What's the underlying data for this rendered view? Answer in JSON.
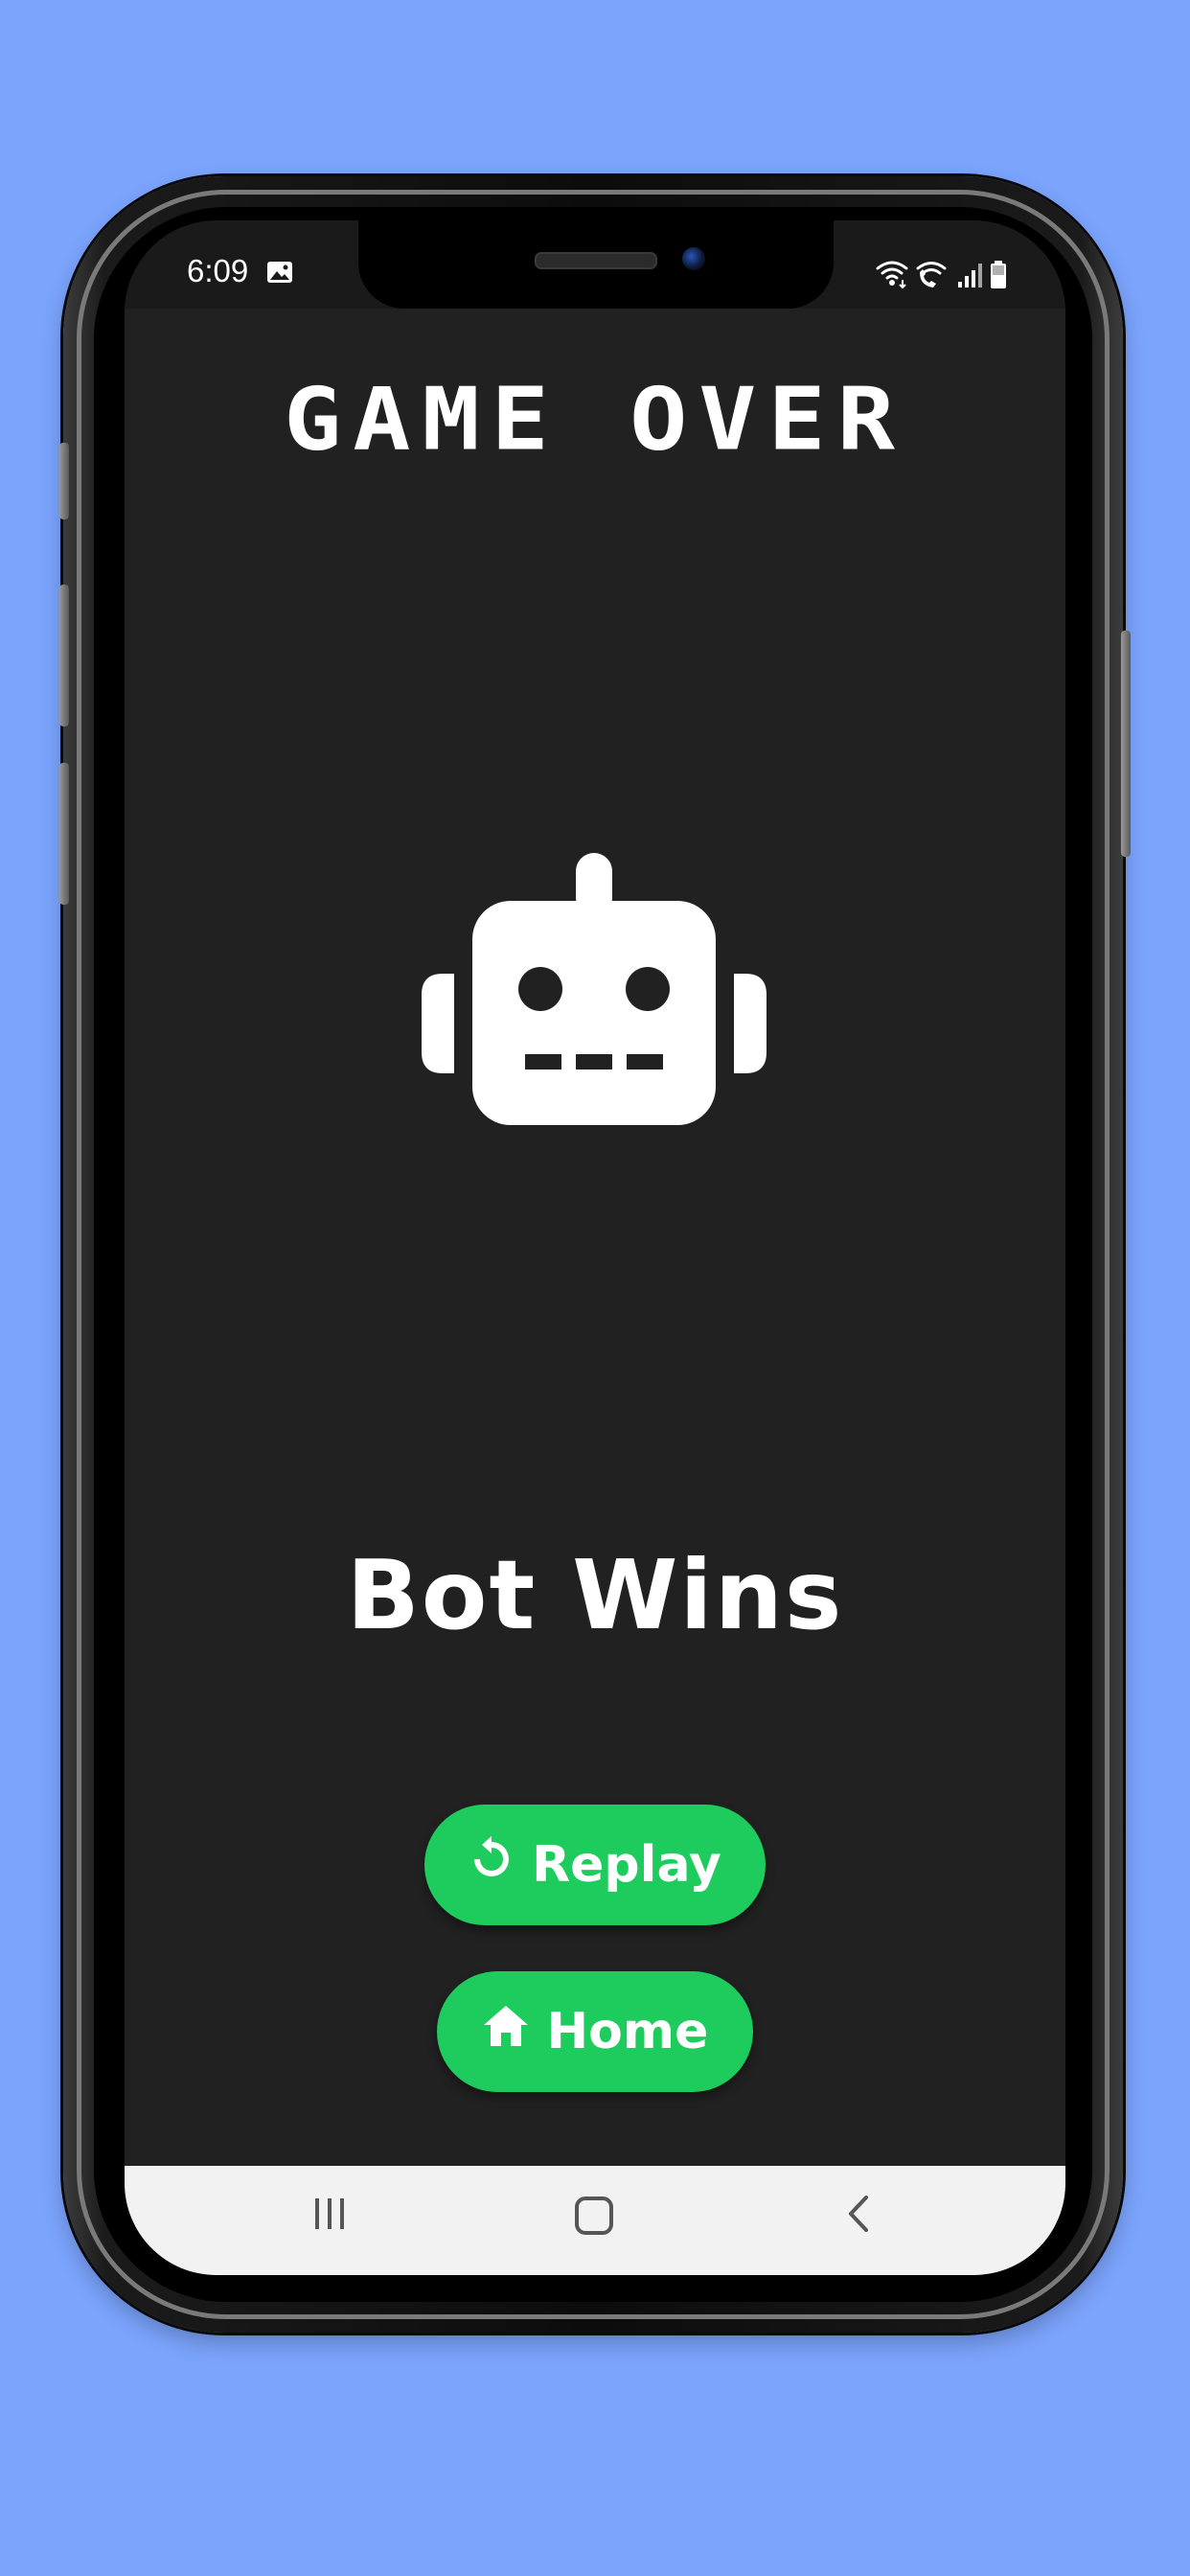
{
  "status_bar": {
    "time": "6:09",
    "left_icons": [
      "gallery-icon"
    ],
    "right_icons": [
      "wifi-call-icon",
      "wifi-calling-icon",
      "signal-icon",
      "battery-icon"
    ]
  },
  "game": {
    "title": "GAME OVER",
    "winner_icon": "robot-icon",
    "result_text": "Bot Wins"
  },
  "buttons": {
    "replay_label": "Replay",
    "replay_icon": "replay-icon",
    "home_label": "Home",
    "home_icon": "home-icon"
  },
  "nav_bar": {
    "items": [
      "recent-apps-icon",
      "home-nav-icon",
      "back-icon"
    ]
  },
  "colors": {
    "page_background": "#7ba4fd",
    "screen_background": "#212121",
    "accent_green": "#1dcc5c",
    "text": "#ffffff",
    "nav_bar": "#f2f2f2"
  }
}
